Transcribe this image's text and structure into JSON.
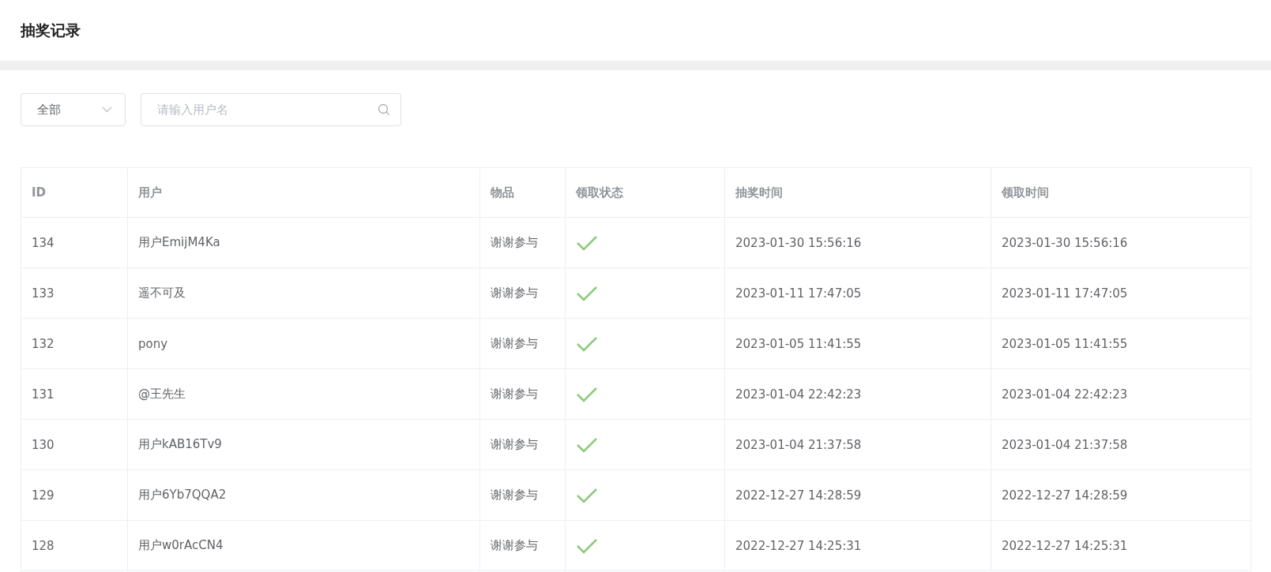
{
  "page": {
    "title": "抽奖记录"
  },
  "filters": {
    "select": {
      "value": "全部"
    },
    "search": {
      "placeholder": "请输入用户名"
    }
  },
  "table": {
    "columns": [
      "ID",
      "用户",
      "物品",
      "领取状态",
      "抽奖时间",
      "领取时间"
    ],
    "rows": [
      {
        "id": "134",
        "user": "用户EmijM4Ka",
        "item": "谢谢参与",
        "claimed": true,
        "draw_time": "2023-01-30 15:56:16",
        "claim_time": "2023-01-30 15:56:16"
      },
      {
        "id": "133",
        "user": "遥不可及",
        "item": "谢谢参与",
        "claimed": true,
        "draw_time": "2023-01-11 17:47:05",
        "claim_time": "2023-01-11 17:47:05"
      },
      {
        "id": "132",
        "user": "pony",
        "item": "谢谢参与",
        "claimed": true,
        "draw_time": "2023-01-05 11:41:55",
        "claim_time": "2023-01-05 11:41:55"
      },
      {
        "id": "131",
        "user": "@王先生",
        "item": "谢谢参与",
        "claimed": true,
        "draw_time": "2023-01-04 22:42:23",
        "claim_time": "2023-01-04 22:42:23"
      },
      {
        "id": "130",
        "user": "用户kAB16Tv9",
        "item": "谢谢参与",
        "claimed": true,
        "draw_time": "2023-01-04 21:37:58",
        "claim_time": "2023-01-04 21:37:58"
      },
      {
        "id": "129",
        "user": "用户6Yb7QQA2",
        "item": "谢谢参与",
        "claimed": true,
        "draw_time": "2022-12-27 14:28:59",
        "claim_time": "2022-12-27 14:28:59"
      },
      {
        "id": "128",
        "user": "用户w0rAcCN4",
        "item": "谢谢参与",
        "claimed": true,
        "draw_time": "2022-12-27 14:25:31",
        "claim_time": "2022-12-27 14:25:31"
      }
    ]
  }
}
